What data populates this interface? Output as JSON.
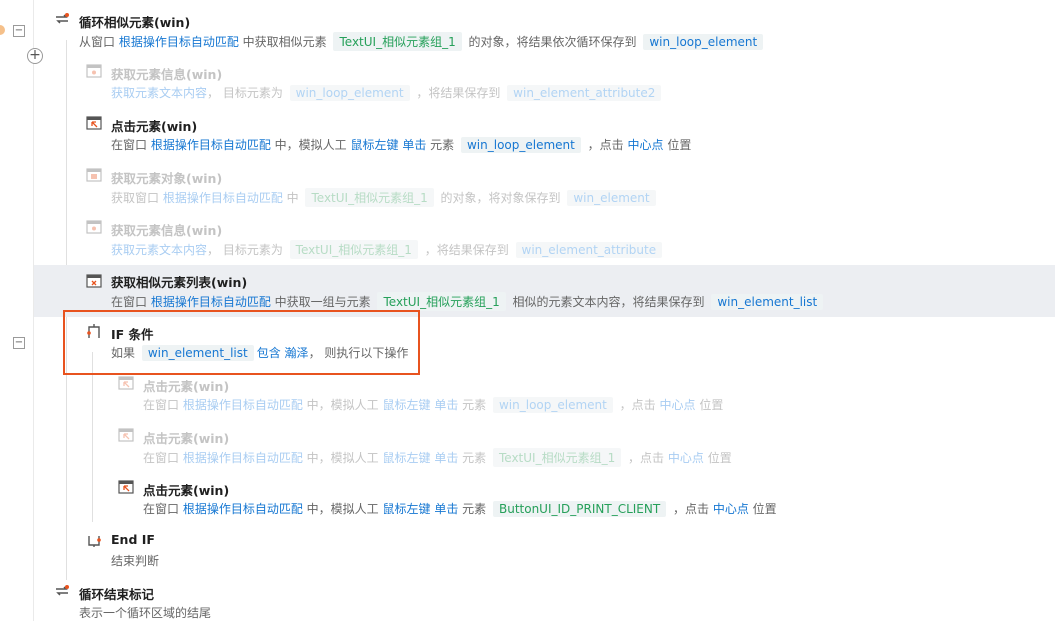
{
  "steps": [
    {
      "title": "循环相似元素(win)",
      "disabled": false,
      "parts": [
        {
          "t": "text",
          "v": "从窗口 "
        },
        {
          "t": "blue",
          "v": "根据操作目标自动匹配"
        },
        {
          "t": "text",
          "v": " 中获取相似元素 "
        },
        {
          "t": "chip",
          "v": "TextUI_相似元素组_1"
        },
        {
          "t": "text",
          "v": " 的对象，将结果依次循环保存到 "
        },
        {
          "t": "var",
          "v": "win_loop_element"
        }
      ]
    },
    {
      "title": "获取元素信息(win)",
      "disabled": true,
      "parts": [
        {
          "t": "blue",
          "v": "获取元素文本内容"
        },
        {
          "t": "text",
          "v": "， 目标元素为 "
        },
        {
          "t": "var",
          "v": "win_loop_element"
        },
        {
          "t": "text",
          "v": " ，将结果保存到 "
        },
        {
          "t": "var",
          "v": "win_element_attribute2"
        }
      ]
    },
    {
      "title": "点击元素(win)",
      "disabled": false,
      "parts": [
        {
          "t": "text",
          "v": "在窗口 "
        },
        {
          "t": "blue",
          "v": "根据操作目标自动匹配"
        },
        {
          "t": "text",
          "v": " 中，模拟人工 "
        },
        {
          "t": "blue",
          "v": "鼠标左键"
        },
        {
          "t": "text",
          "v": " "
        },
        {
          "t": "blue",
          "v": "单击"
        },
        {
          "t": "text",
          "v": " 元素 "
        },
        {
          "t": "var",
          "v": "win_loop_element"
        },
        {
          "t": "text",
          "v": " ，点击 "
        },
        {
          "t": "blue",
          "v": "中心点"
        },
        {
          "t": "text",
          "v": " 位置"
        }
      ]
    },
    {
      "title": "获取元素对象(win)",
      "disabled": true,
      "parts": [
        {
          "t": "text",
          "v": "获取窗口 "
        },
        {
          "t": "blue",
          "v": "根据操作目标自动匹配"
        },
        {
          "t": "text",
          "v": " 中 "
        },
        {
          "t": "chip",
          "v": "TextUI_相似元素组_1"
        },
        {
          "t": "text",
          "v": " 的对象，将对象保存到 "
        },
        {
          "t": "var",
          "v": "win_element"
        }
      ]
    },
    {
      "title": "获取元素信息(win)",
      "disabled": true,
      "parts": [
        {
          "t": "blue",
          "v": "获取元素文本内容"
        },
        {
          "t": "text",
          "v": "， 目标元素为 "
        },
        {
          "t": "chip",
          "v": "TextUI_相似元素组_1"
        },
        {
          "t": "text",
          "v": " ，将结果保存到 "
        },
        {
          "t": "var",
          "v": "win_element_attribute"
        }
      ]
    },
    {
      "title": "获取相似元素列表(win)",
      "disabled": false,
      "parts": [
        {
          "t": "text",
          "v": "在窗口 "
        },
        {
          "t": "blue",
          "v": "根据操作目标自动匹配"
        },
        {
          "t": "text",
          "v": " 中获取一组与元素 "
        },
        {
          "t": "chip",
          "v": "TextUI_相似元素组_1"
        },
        {
          "t": "text",
          "v": " 相似的元素文本内容，将结果保存到 "
        },
        {
          "t": "var",
          "v": "win_element_list"
        }
      ]
    },
    {
      "title": "IF 条件",
      "disabled": false,
      "parts": [
        {
          "t": "text",
          "v": "如果 "
        },
        {
          "t": "var",
          "v": "win_element_list"
        },
        {
          "t": "blue",
          "v": "包含"
        },
        {
          "t": "text",
          "v": " "
        },
        {
          "t": "blue",
          "v": "瀚泽"
        },
        {
          "t": "text",
          "v": "， 则执行以下操作"
        }
      ]
    },
    {
      "title": "点击元素(win)",
      "disabled": true,
      "parts": [
        {
          "t": "text",
          "v": "在窗口 "
        },
        {
          "t": "blue",
          "v": "根据操作目标自动匹配"
        },
        {
          "t": "text",
          "v": " 中，模拟人工 "
        },
        {
          "t": "blue",
          "v": "鼠标左键"
        },
        {
          "t": "text",
          "v": " "
        },
        {
          "t": "blue",
          "v": "单击"
        },
        {
          "t": "text",
          "v": " 元素 "
        },
        {
          "t": "var",
          "v": "win_loop_element"
        },
        {
          "t": "text",
          "v": " ，点击 "
        },
        {
          "t": "blue",
          "v": "中心点"
        },
        {
          "t": "text",
          "v": " 位置"
        }
      ]
    },
    {
      "title": "点击元素(win)",
      "disabled": true,
      "parts": [
        {
          "t": "text",
          "v": "在窗口 "
        },
        {
          "t": "blue",
          "v": "根据操作目标自动匹配"
        },
        {
          "t": "text",
          "v": " 中，模拟人工 "
        },
        {
          "t": "blue",
          "v": "鼠标左键"
        },
        {
          "t": "text",
          "v": " "
        },
        {
          "t": "blue",
          "v": "单击"
        },
        {
          "t": "text",
          "v": " 元素 "
        },
        {
          "t": "chip",
          "v": "TextUI_相似元素组_1"
        },
        {
          "t": "text",
          "v": " ，点击 "
        },
        {
          "t": "blue",
          "v": "中心点"
        },
        {
          "t": "text",
          "v": " 位置"
        }
      ]
    },
    {
      "title": "点击元素(win)",
      "disabled": false,
      "parts": [
        {
          "t": "text",
          "v": "在窗口 "
        },
        {
          "t": "blue",
          "v": "根据操作目标自动匹配"
        },
        {
          "t": "text",
          "v": " 中，模拟人工 "
        },
        {
          "t": "blue",
          "v": "鼠标左键"
        },
        {
          "t": "text",
          "v": " "
        },
        {
          "t": "blue",
          "v": "单击"
        },
        {
          "t": "text",
          "v": " 元素 "
        },
        {
          "t": "chip",
          "v": "ButtonUI_ID_PRINT_CLIENT"
        },
        {
          "t": "text",
          "v": " ，点击 "
        },
        {
          "t": "blue",
          "v": "中心点"
        },
        {
          "t": "text",
          "v": " 位置"
        }
      ]
    },
    {
      "title": "End IF",
      "disabled": false,
      "parts": [
        {
          "t": "text",
          "v": "结束判断"
        }
      ]
    },
    {
      "title": "循环结束标记",
      "disabled": false,
      "parts": [
        {
          "t": "text",
          "v": "表示一个循环区域的结尾"
        }
      ]
    }
  ],
  "colors": {
    "accent": "#1677d2",
    "chip_text": "#26a05a",
    "highlight": "#e8531f",
    "selected_bg": "#eceef2"
  },
  "icons": [
    "loop-icon",
    "info-icon",
    "click-icon",
    "object-icon",
    "list-icon",
    "if-icon",
    "endif-icon",
    "loop-end-icon"
  ]
}
